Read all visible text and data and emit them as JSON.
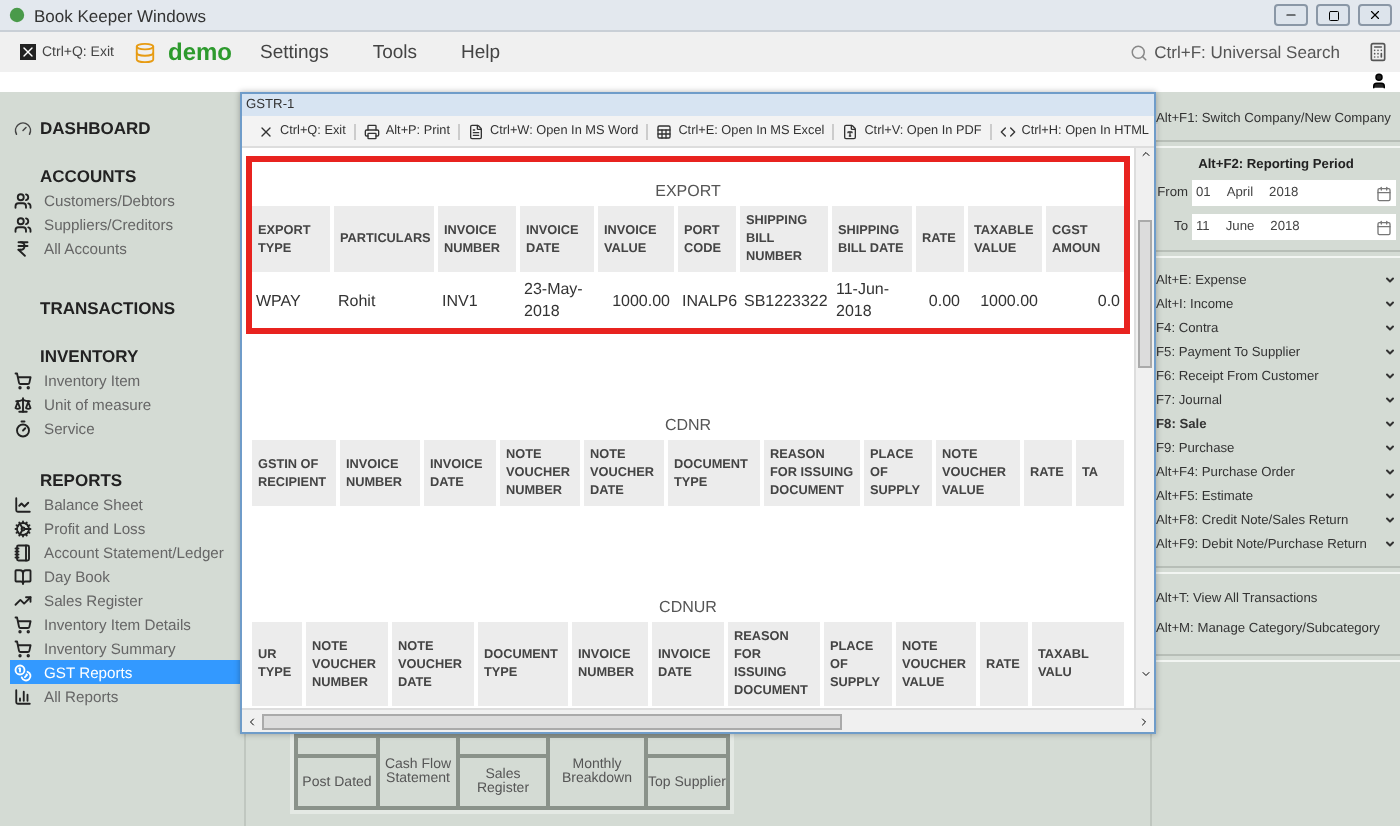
{
  "app_title": "Book Keeper Windows",
  "menu": {
    "exit": "Ctrl+Q: Exit",
    "company": "demo",
    "items": [
      "Settings",
      "Tools",
      "Help"
    ],
    "search": "Ctrl+F: Universal Search"
  },
  "sidebar": {
    "dashboard": "DASHBOARD",
    "sections": [
      {
        "title": "ACCOUNTS",
        "items": [
          {
            "label": "Customers/Debtors",
            "selected": false
          },
          {
            "label": "Suppliers/Creditors",
            "selected": false
          },
          {
            "label": "All Accounts",
            "selected": false
          }
        ]
      },
      {
        "title": "TRANSACTIONS"
      },
      {
        "title": "INVENTORY",
        "items": [
          {
            "label": "Inventory Item",
            "selected": false
          },
          {
            "label": "Unit of measure",
            "selected": false
          },
          {
            "label": "Service",
            "selected": false
          }
        ]
      },
      {
        "title": "REPORTS",
        "items": [
          {
            "label": "Balance Sheet",
            "selected": false
          },
          {
            "label": "Profit and Loss",
            "selected": false
          },
          {
            "label": "Account Statement/Ledger",
            "selected": false
          },
          {
            "label": "Day Book",
            "selected": false
          },
          {
            "label": "Sales Register",
            "selected": false
          },
          {
            "label": "Inventory Item Details",
            "selected": false
          },
          {
            "label": "Inventory Summary",
            "selected": false
          },
          {
            "label": "GST Reports",
            "selected": true
          },
          {
            "label": "All Reports",
            "selected": false
          }
        ]
      }
    ]
  },
  "shortcuts": [
    "Post Dated",
    "Cash Flow Statement",
    "Sales Register",
    "Monthly Breakdown",
    "Top Supplier"
  ],
  "gstr_window": {
    "title": "GSTR-1",
    "toolbar": [
      "Ctrl+Q: Exit",
      "Alt+P: Print",
      "Ctrl+W: Open In MS Word",
      "Ctrl+E: Open In MS Excel",
      "Ctrl+V: Open In PDF",
      "Ctrl+H: Open In HTML"
    ],
    "sections": [
      {
        "title": "EXPORT",
        "highlighted": true,
        "columns": [
          "EXPORT TYPE",
          "PARTICULARS",
          "INVOICE NUMBER",
          "INVOICE DATE",
          "INVOICE VALUE",
          "PORT CODE",
          "SHIPPING BILL NUMBER",
          "SHIPPING BILL DATE",
          "RATE",
          "TAXABLE VALUE",
          "CGST AMOUN"
        ],
        "rows": [
          [
            "WPAY",
            "Rohit",
            "INV1",
            "23-May-2018",
            "1000.00",
            "INALP6",
            "SB1223322",
            "11-Jun-2018",
            "0.00",
            "1000.00",
            "0.0"
          ]
        ]
      },
      {
        "title": "CDNR",
        "highlighted": false,
        "columns": [
          "GSTIN OF RECIPIENT",
          "INVOICE NUMBER",
          "INVOICE DATE",
          "NOTE VOUCHER NUMBER",
          "NOTE VOUCHER DATE",
          "DOCUMENT TYPE",
          "REASON FOR ISSUING DOCUMENT",
          "PLACE OF SUPPLY",
          "NOTE VOUCHER VALUE",
          "RATE",
          "TA"
        ]
      },
      {
        "title": "CDNUR",
        "highlighted": false,
        "columns": [
          "UR TYPE",
          "NOTE VOUCHER NUMBER",
          "NOTE VOUCHER DATE",
          "DOCUMENT TYPE",
          "INVOICE NUMBER",
          "INVOICE DATE",
          "REASON FOR ISSUING DOCUMENT",
          "PLACE OF SUPPLY",
          "NOTE VOUCHER VALUE",
          "RATE",
          "TAXABL VALU"
        ]
      }
    ]
  },
  "right_panel": {
    "switch": "Alt+F1: Switch Company/New Company",
    "period": {
      "title": "Alt+F2: Reporting Period",
      "from": {
        "label": "From",
        "day": "01",
        "month": "April",
        "year": "2018"
      },
      "to": {
        "label": "To",
        "day": "11",
        "month": "June",
        "year": "2018"
      }
    },
    "actions": [
      {
        "label": "Alt+E: Expense",
        "bold": false
      },
      {
        "label": "Alt+I: Income",
        "bold": false
      },
      {
        "label": "F4: Contra",
        "bold": false
      },
      {
        "label": "F5: Payment To Supplier",
        "bold": false
      },
      {
        "label": "F6: Receipt From Customer",
        "bold": false
      },
      {
        "label": "F7: Journal",
        "bold": false
      },
      {
        "label": "F8: Sale",
        "bold": true
      },
      {
        "label": "F9: Purchase",
        "bold": false
      },
      {
        "label": "Alt+F4: Purchase Order",
        "bold": false
      },
      {
        "label": "Alt+F5: Estimate",
        "bold": false
      },
      {
        "label": "Alt+F8: Credit Note/Sales Return",
        "bold": false
      },
      {
        "label": "Alt+F9: Debit Note/Purchase Return",
        "bold": false
      }
    ],
    "links": [
      "Alt+T: View All Transactions",
      "Alt+M: Manage Category/Subcategory"
    ]
  }
}
